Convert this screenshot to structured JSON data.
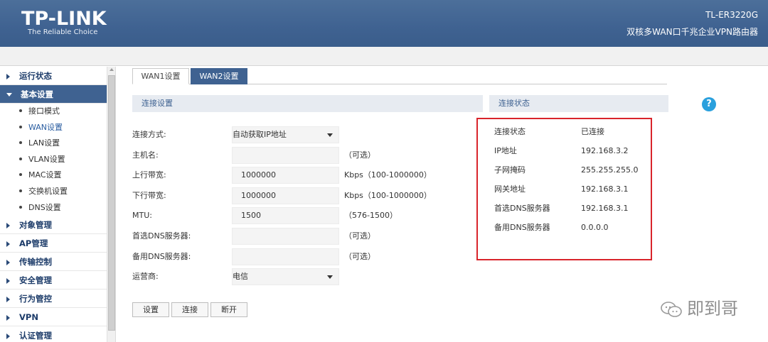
{
  "header": {
    "brand": "TP-LINK",
    "tagline": "The Reliable Choice",
    "model": "TL-ER3220G",
    "description": "双核多WAN口千兆企业VPN路由器"
  },
  "sidebar": {
    "items": [
      {
        "label": "运行状态",
        "type": "top"
      },
      {
        "label": "基本设置",
        "type": "top-active"
      },
      {
        "label": "接口模式",
        "type": "sub"
      },
      {
        "label": "WAN设置",
        "type": "sub-active"
      },
      {
        "label": "LAN设置",
        "type": "sub"
      },
      {
        "label": "VLAN设置",
        "type": "sub"
      },
      {
        "label": "MAC设置",
        "type": "sub"
      },
      {
        "label": "交换机设置",
        "type": "sub"
      },
      {
        "label": "DNS设置",
        "type": "sub"
      },
      {
        "label": "对象管理",
        "type": "top"
      },
      {
        "label": "AP管理",
        "type": "top"
      },
      {
        "label": "传输控制",
        "type": "top"
      },
      {
        "label": "安全管理",
        "type": "top"
      },
      {
        "label": "行为管控",
        "type": "top"
      },
      {
        "label": "VPN",
        "type": "top"
      },
      {
        "label": "认证管理",
        "type": "top"
      }
    ]
  },
  "tabs": [
    {
      "label": "WAN1设置",
      "active": false
    },
    {
      "label": "WAN2设置",
      "active": true
    }
  ],
  "connection_settings": {
    "title": "连接设置",
    "fields": [
      {
        "label": "连接方式:",
        "value": "自动获取IP地址",
        "kind": "select",
        "hint": ""
      },
      {
        "label": "主机名:",
        "value": "",
        "kind": "input",
        "hint": "（可选）"
      },
      {
        "label": "上行带宽:",
        "value": "1000000",
        "kind": "input",
        "hint": "Kbps（100-1000000）"
      },
      {
        "label": "下行带宽:",
        "value": "1000000",
        "kind": "input",
        "hint": "Kbps（100-1000000）"
      },
      {
        "label": "MTU:",
        "value": "1500",
        "kind": "input",
        "hint": "（576-1500）"
      },
      {
        "label": "首选DNS服务器:",
        "value": "",
        "kind": "input",
        "hint": "（可选）"
      },
      {
        "label": "备用DNS服务器:",
        "value": "",
        "kind": "input",
        "hint": "（可选）"
      },
      {
        "label": "运营商:",
        "value": "电信",
        "kind": "select",
        "hint": ""
      }
    ],
    "buttons": {
      "save": "设置",
      "connect": "连接",
      "disconnect": "断开"
    }
  },
  "connection_status": {
    "title": "连接状态",
    "rows": [
      {
        "key": "连接状态",
        "value": "已连接"
      },
      {
        "key": "IP地址",
        "value": "192.168.3.2"
      },
      {
        "key": "子网掩码",
        "value": "255.255.255.0"
      },
      {
        "key": "网关地址",
        "value": "192.168.3.1"
      },
      {
        "key": "首选DNS服务器",
        "value": "192.168.3.1"
      },
      {
        "key": "备用DNS服务器",
        "value": "0.0.0.0"
      }
    ]
  },
  "help": {
    "glyph": "?"
  },
  "watermark": {
    "text": "即到哥"
  },
  "colors": {
    "header_blue": "#3f6291",
    "highlight_red": "#d9242b",
    "help_blue": "#2aa0dd"
  }
}
